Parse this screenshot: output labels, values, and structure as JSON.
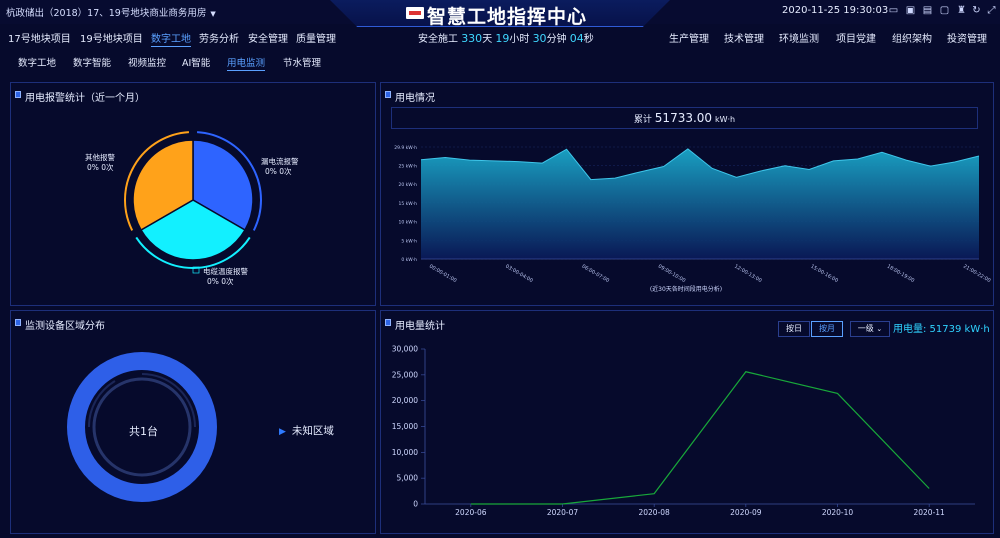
{
  "header": {
    "project_selector": "杭政储出（2018）17、19号地块商业商务用房",
    "title": "智慧工地指挥中心",
    "datetime": "2020-11-25 19:30:03",
    "icons": [
      "monitor-icon",
      "screen-icon",
      "list-icon",
      "folder-icon",
      "shirt-icon",
      "refresh-icon",
      "fullscreen-icon"
    ]
  },
  "nav": {
    "tabs": [
      "17号地块项目",
      "19号地块项目",
      "数字工地",
      "劳务分析",
      "安全管理",
      "质量管理"
    ],
    "active_tab": "数字工地",
    "right_tabs": [
      "生产管理",
      "技术管理",
      "环境监测",
      "项目党建",
      "组织架构",
      "投资管理"
    ]
  },
  "safety": {
    "prefix": "安全施工",
    "days": "330",
    "d_unit": "天",
    "hours": "19",
    "h_unit": "小时",
    "minutes": "30",
    "m_unit": "分钟",
    "seconds": "04",
    "s_unit": "秒"
  },
  "subnav": {
    "items": [
      "数字工地",
      "数字智能",
      "视频监控",
      "AI智能",
      "用电监测",
      "节水管理"
    ],
    "active": "用电监测"
  },
  "alarm_panel": {
    "title": "用电报警统计（近一个月）",
    "labels": [
      {
        "name": "其他报警",
        "value": "0%  0次"
      },
      {
        "name": "漏电流报警",
        "value": "0%  0次"
      },
      {
        "name": "电缆温度报警",
        "value": "0%  0次"
      }
    ]
  },
  "usage_panel": {
    "title": "用电情况",
    "total_prefix": "累计",
    "total_value": "51733.00",
    "total_unit": "kW·h",
    "footnote": "(近30天各时间段用电分析)"
  },
  "device_panel": {
    "title": "监测设备区域分布",
    "center_label": "共1台",
    "legend": "未知区域"
  },
  "stats_panel": {
    "title": "用电量统计",
    "btn_day": "按日",
    "btn_month": "按月",
    "active_btn": "按月",
    "level": "一级",
    "usage_label": "用电量: 51739 kW·h"
  },
  "colors": {
    "accent": "#2f7bff",
    "cyan": "#12f0ff",
    "orange": "#ffa21a",
    "blue": "#2e64ff",
    "line_green": "#18a83a"
  },
  "chart_data": [
    {
      "type": "pie",
      "title": "用电报警统计（近一个月）",
      "categories": [
        "漏电流报警",
        "电缆温度报警",
        "其他报警"
      ],
      "values": [
        33.3,
        33.3,
        33.3
      ],
      "note": "all counts are 0; slices drawn equally"
    },
    {
      "type": "area",
      "title": "用电情况",
      "x": [
        "00:00-01:00",
        "03:00-04:00",
        "06:00-07:00",
        "09:00-10:00",
        "12:00-13:00",
        "15:00-16:00",
        "18:00-19:00",
        "21:00-22:00"
      ],
      "y_tick_labels": [
        "0 kW·h",
        "5 kW·h",
        "10 kW·h",
        "15 kW·h",
        "20 kW·h",
        "25 kW·h",
        "29.9 kW·h"
      ],
      "ylim": [
        0,
        29.9
      ],
      "values": [
        26.5,
        27.1,
        26.4,
        26.2,
        26.0,
        25.6,
        29.3,
        21.2,
        21.6,
        23.2,
        24.7,
        29.4,
        24.2,
        21.8,
        23.5,
        24.9,
        23.9,
        26.2,
        26.7,
        28.5,
        26.4,
        24.8,
        25.9,
        27.5
      ]
    },
    {
      "type": "line",
      "title": "用电量统计",
      "categories": [
        "2020-06",
        "2020-07",
        "2020-08",
        "2020-09",
        "2020-10",
        "2020-11"
      ],
      "values": [
        0,
        0,
        2000,
        25600,
        21400,
        3000
      ],
      "y_ticks": [
        "0",
        "5,000",
        "10,000",
        "15,000",
        "20,000",
        "25,000",
        "30,000"
      ],
      "ylim": [
        0,
        30000
      ]
    }
  ]
}
